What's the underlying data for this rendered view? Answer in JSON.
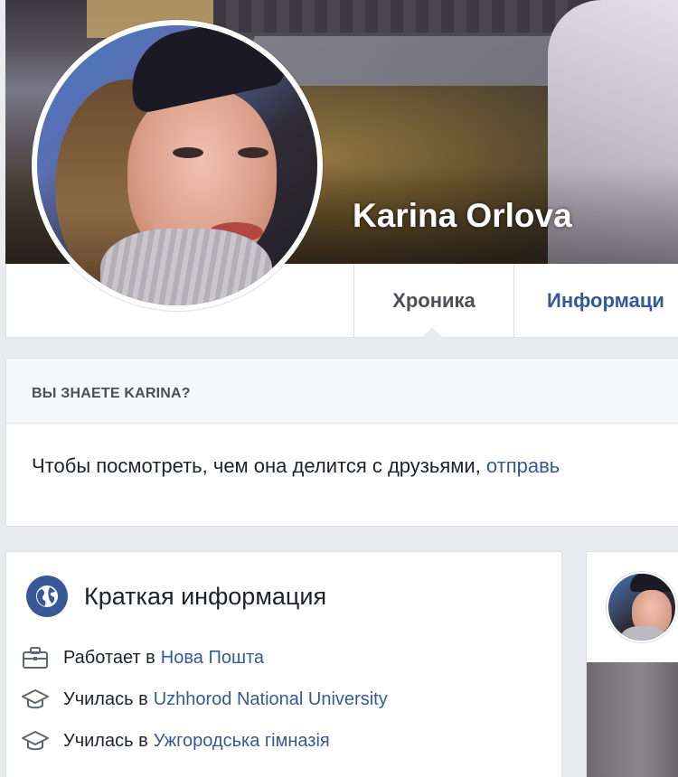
{
  "profile": {
    "name": "Karina Orlova"
  },
  "tabs": {
    "chronicle": "Хроника",
    "info": "Информаци"
  },
  "know_card": {
    "heading": "ВЫ ЗНАЕТЕ KARINA?",
    "text": "Чтобы посмотреть, чем она делится с друзьями,",
    "link": "отправь"
  },
  "intro": {
    "title": "Краткая информация",
    "rows": [
      {
        "icon": "briefcase-icon",
        "prefix": "Работает в",
        "link": "Нова Пошта"
      },
      {
        "icon": "graduation-cap-icon",
        "prefix": "Училась в",
        "link": "Uzhhorod National University"
      },
      {
        "icon": "graduation-cap-icon",
        "prefix": "Училась в",
        "link": "Ужгородська гімназія"
      }
    ]
  },
  "colors": {
    "link": "#365899",
    "background": "#e9ebee",
    "globe": "#385898"
  }
}
